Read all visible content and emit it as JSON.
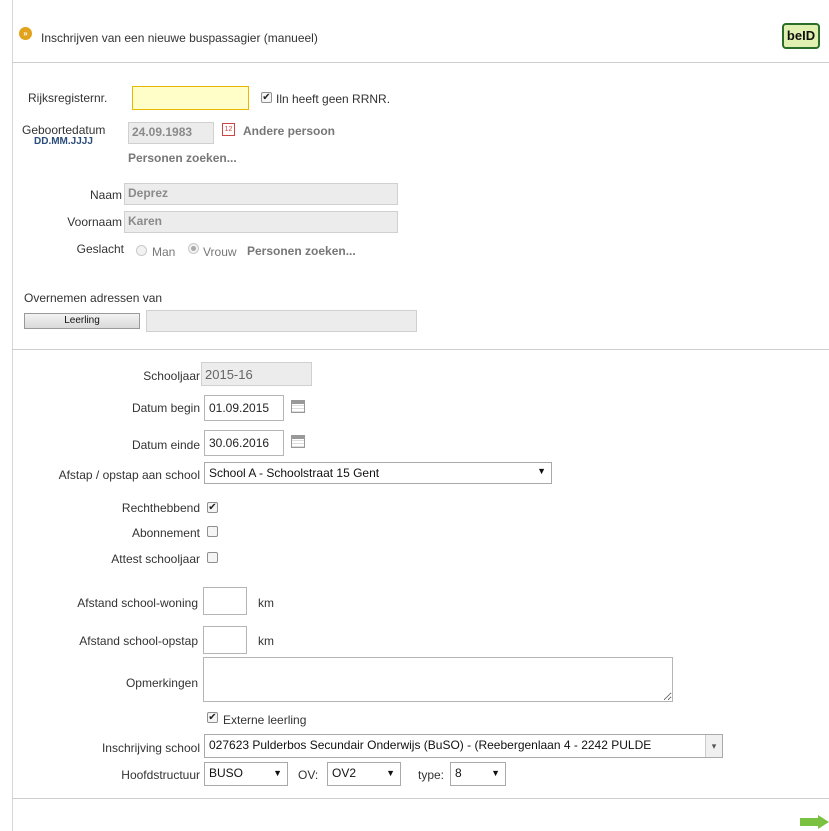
{
  "header": {
    "title": "Inschrijven van een nieuwe buspassagier (manueel)",
    "logo": "beID"
  },
  "identity": {
    "rijksregister_label": "Rijksregisternr.",
    "rijksregister_value": "",
    "no_rrnr_label": "Iln heeft geen RRNR.",
    "no_rrnr_checked": true,
    "geboortedatum_label": "Geboortedatum",
    "geboortedatum_format": "DD.MM.JJJJ",
    "geboortedatum_value": "24.09.1983",
    "andere_persoon": "Andere persoon",
    "personen_zoeken_1": "Personen zoeken...",
    "naam_label": "Naam",
    "naam_value": "Deprez",
    "voornaam_label": "Voornaam",
    "voornaam_value": "Karen",
    "geslacht_label": "Geslacht",
    "geslacht_man": "Man",
    "geslacht_vrouw": "Vrouw",
    "geslacht_selected": "Vrouw",
    "personen_zoeken_2": "Personen zoeken...",
    "overnemen_label": "Overnemen adressen van",
    "leerling_button": "Leerling",
    "leerling_value": ""
  },
  "school": {
    "schooljaar_label": "Schooljaar",
    "schooljaar_value": "2015-16",
    "datum_begin_label": "Datum begin",
    "datum_begin_value": "01.09.2015",
    "datum_einde_label": "Datum einde",
    "datum_einde_value": "30.06.2016",
    "afstap_label": "Afstap / opstap aan school",
    "afstap_value": "School A - Schoolstraat 15 Gent",
    "rechthebbend_label": "Rechthebbend",
    "rechthebbend_checked": true,
    "abonnement_label": "Abonnement",
    "abonnement_checked": false,
    "attest_label": "Attest schooljaar",
    "attest_checked": false,
    "afstand_woning_label": "Afstand school-woning",
    "afstand_woning_value": "",
    "afstand_opstap_label": "Afstand school-opstap",
    "afstand_opstap_value": "",
    "km_unit": "km",
    "opmerkingen_label": "Opmerkingen",
    "opmerkingen_value": "",
    "externe_label": "Externe leerling",
    "externe_checked": true,
    "inschrijving_label": "Inschrijving school",
    "inschrijving_value": "027623 Pulderbos Secundair Onderwijs (BuSO) - (Reebergenlaan 4 - 2242 PULDE",
    "hoofdstructuur_label": "Hoofdstructuur",
    "hoofdstructuur_value": "BUSO",
    "ov_label": "OV:",
    "ov_value": "OV2",
    "type_label": "type:",
    "type_value": "8"
  },
  "colors": {
    "rrnr_highlight": "#fffdc8",
    "rrnr_border": "#e6b800",
    "next_arrow": "#7ac142",
    "header_icon": "#e2a21b"
  }
}
